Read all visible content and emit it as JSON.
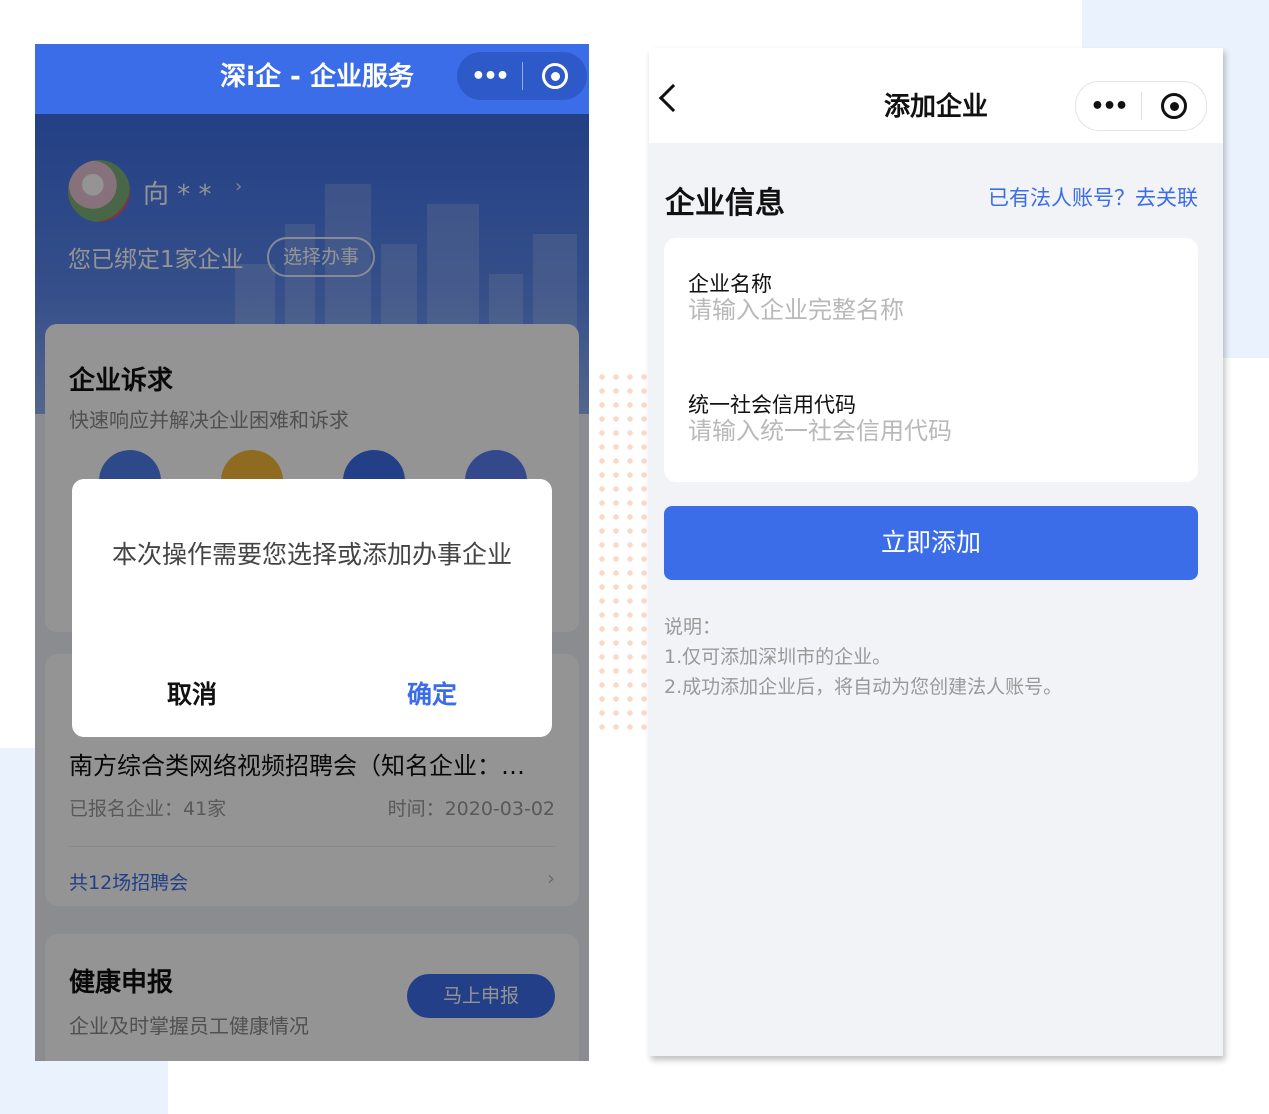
{
  "left_phone": {
    "nav": {
      "title": "深i企 - 企业服务",
      "more": "•••"
    },
    "user": {
      "name": "向 * *",
      "arrow": "›"
    },
    "bind_text": "您已绑定1家企业",
    "select_button": "选择办事",
    "appeal_card": {
      "title": "企业诉求",
      "subtitle": "快速响应并解决企业困难和诉求"
    },
    "job_card": {
      "title": "南方综合类网络视频招聘会（知名企业：…",
      "count": "已报名企业：41家",
      "time": "时间：2020-03-02",
      "total": "共12场招聘会",
      "chevron": "›"
    },
    "health_card": {
      "title": "健康申报",
      "subtitle": "企业及时掌握员工健康情况",
      "button": "马上申报"
    },
    "dialog": {
      "message": "本次操作需要您选择或添加办事企业",
      "cancel": "取消",
      "confirm": "确定"
    }
  },
  "right_phone": {
    "nav": {
      "title": "添加企业",
      "more": "•••"
    },
    "section_title": "企业信息",
    "link": "已有法人账号？去关联",
    "form": {
      "name_label": "企业名称",
      "name_placeholder": "请输入企业完整名称",
      "code_label": "统一社会信用代码",
      "code_placeholder": "请输入统一社会信用代码"
    },
    "submit": "立即添加",
    "notes": {
      "title": "说明：",
      "line1": "1.仅可添加深圳市的企业。",
      "line2": "2.成功添加企业后，将自动为您创建法人账号。"
    }
  },
  "colors": {
    "primary": "#3c6de8",
    "page_bg": "#f2f3f7",
    "deco": "#eaf2fe"
  }
}
